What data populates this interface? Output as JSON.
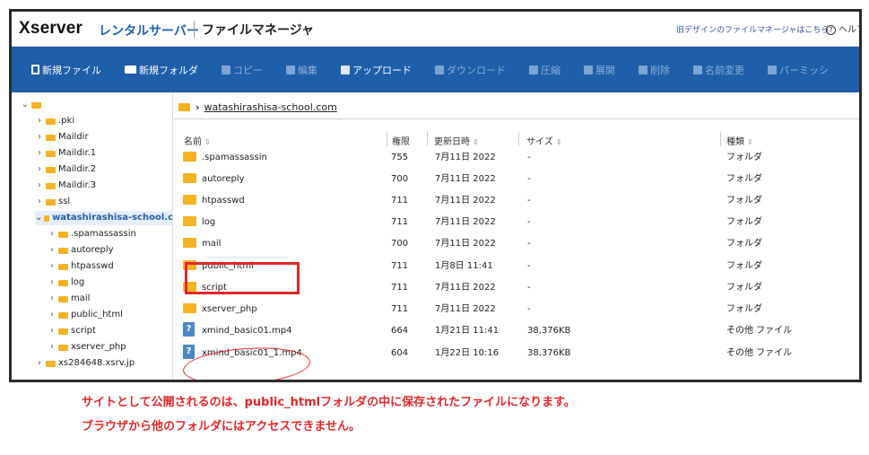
{
  "header": {
    "brand": "Xserver",
    "brand_sub": "レンタルサーバー",
    "title": "ファイルマネージャ",
    "old_design_link": "旧デザインのファイルマネージャはこちら",
    "help": "ヘルプ"
  },
  "toolbar": {
    "new_file": "新規ファイル",
    "new_folder": "新規フォルダ",
    "copy": "コピー",
    "edit": "編集",
    "upload": "アップロード",
    "download": "ダウンロード",
    "compress": "圧縮",
    "extract": "展開",
    "delete": "削除",
    "rename": "名前変更",
    "permission": "パーミッシ"
  },
  "sidebar": {
    "items": [
      {
        "label": ".pki"
      },
      {
        "label": "Maildir"
      },
      {
        "label": "Maildir.1"
      },
      {
        "label": "Maildir.2"
      },
      {
        "label": "Maildir.3"
      },
      {
        "label": "ssl"
      },
      {
        "label": "watashirashisa-school.c"
      },
      {
        "label": ".spamassassin"
      },
      {
        "label": "autoreply"
      },
      {
        "label": "htpasswd"
      },
      {
        "label": "log"
      },
      {
        "label": "mail"
      },
      {
        "label": "public_html"
      },
      {
        "label": "script"
      },
      {
        "label": "xserver_php"
      },
      {
        "label": "xs284648.xsrv.jp"
      }
    ]
  },
  "breadcrumb": {
    "current": "watashirashisa-school.com"
  },
  "table": {
    "headers": {
      "name": "名前",
      "perm": "権限",
      "date": "更新日時",
      "size": "サイズ",
      "type": "種類"
    },
    "rows": [
      {
        "name": ".spamassassin",
        "perm": "755",
        "date": "7月11日 2022",
        "size": "-",
        "type": "フォルダ"
      },
      {
        "name": "autoreply",
        "perm": "700",
        "date": "7月11日 2022",
        "size": "-",
        "type": "フォルダ"
      },
      {
        "name": "htpasswd",
        "perm": "711",
        "date": "7月11日 2022",
        "size": "-",
        "type": "フォルダ"
      },
      {
        "name": "log",
        "perm": "711",
        "date": "7月11日 2022",
        "size": "-",
        "type": "フォルダ"
      },
      {
        "name": "mail",
        "perm": "700",
        "date": "7月11日 2022",
        "size": "-",
        "type": "フォルダ"
      },
      {
        "name": "public_html",
        "perm": "711",
        "date": "1月8日 11:41",
        "size": "-",
        "type": "フォルダ"
      },
      {
        "name": "script",
        "perm": "711",
        "date": "7月11日 2022",
        "size": "-",
        "type": "フォルダ"
      },
      {
        "name": "xserver_php",
        "perm": "711",
        "date": "7月11日 2022",
        "size": "-",
        "type": "フォルダ"
      },
      {
        "name": "xmind_basic01.mp4",
        "perm": "664",
        "date": "1月21日 11:41",
        "size": "38,376KB",
        "type": "その他 ファイル"
      },
      {
        "name": "xmind_basic01_1.mp4",
        "perm": "604",
        "date": "1月22日 10:16",
        "size": "38,376KB",
        "type": "その他 ファイル"
      }
    ]
  },
  "caption": {
    "line1": "サイトとして公開されるのは、public_htmlフォルダの中に保存されたファイルになります。",
    "line2": "ブラウザから他のフォルダにはアクセスできません。"
  },
  "colors": {
    "toolbar": "#1f5ea8",
    "folder": "#f3b324",
    "annotation": "#e3262a",
    "brand_blue": "#1f5fb4"
  }
}
